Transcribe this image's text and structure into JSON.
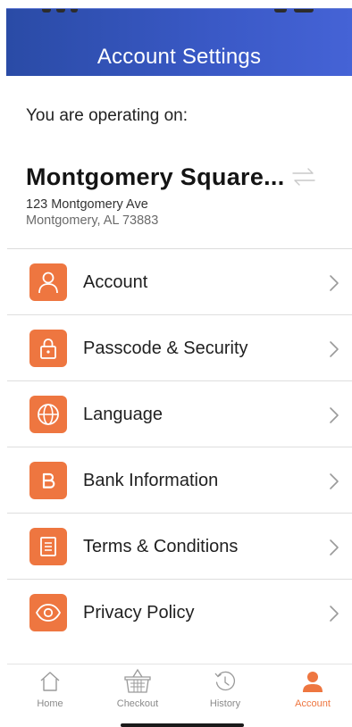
{
  "header": {
    "title": "Account Settings"
  },
  "store": {
    "operating_label": "You are operating on:",
    "name": "Montgomery Square...",
    "address_line1": "123 Montgomery Ave",
    "address_line2": "Montgomery, AL 73883"
  },
  "menu": {
    "items": [
      {
        "label": "Account",
        "icon": "user-icon"
      },
      {
        "label": "Passcode & Security",
        "icon": "lock-icon"
      },
      {
        "label": "Language",
        "icon": "globe-icon"
      },
      {
        "label": "Bank Information",
        "icon": "bank-b-icon"
      },
      {
        "label": "Terms & Conditions",
        "icon": "document-icon"
      },
      {
        "label": "Privacy Policy",
        "icon": "eye-icon"
      }
    ]
  },
  "tabbar": {
    "tabs": [
      {
        "label": "Home",
        "icon": "home-icon",
        "active": false
      },
      {
        "label": "Checkout",
        "icon": "basket-icon",
        "active": false
      },
      {
        "label": "History",
        "icon": "history-icon",
        "active": false
      },
      {
        "label": "Account",
        "icon": "person-icon",
        "active": true
      }
    ]
  },
  "colors": {
    "header_blue": "#3a59c6",
    "accent_orange": "#ee7640",
    "tab_inactive": "#8a8a8a"
  }
}
